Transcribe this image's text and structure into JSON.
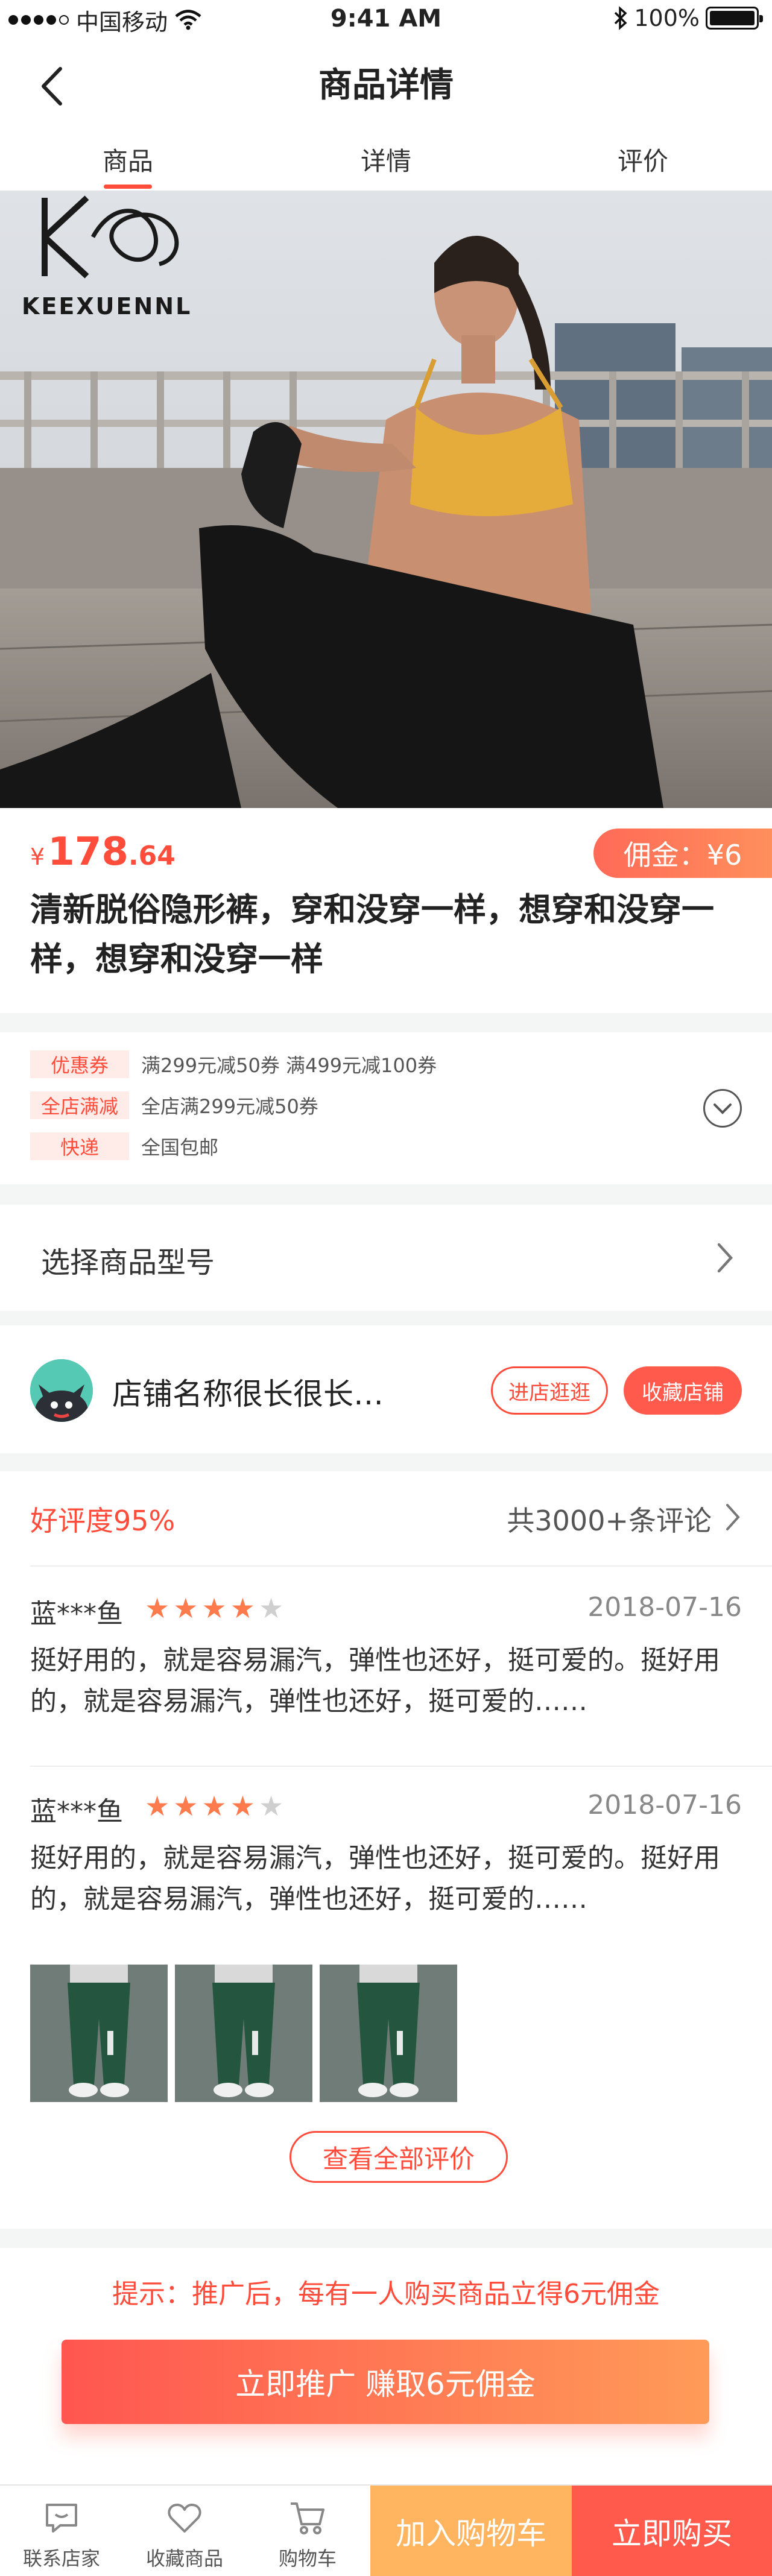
{
  "status_bar": {
    "carrier": "中国移动",
    "time": "9:41 AM",
    "battery": "100%"
  },
  "nav": {
    "title": "商品详情",
    "back_icon": "chevron-left-icon"
  },
  "tabs": [
    {
      "label": "商品",
      "active": true
    },
    {
      "label": "详情",
      "active": false
    },
    {
      "label": "评价",
      "active": false
    }
  ],
  "hero": {
    "brand_logo_text": "KEEXUENNL"
  },
  "product": {
    "price_symbol": "¥",
    "price_int": "178",
    "price_dec": ".64",
    "commission": "佣金：¥6",
    "title": "清新脱俗隐形裤，穿和没穿一样，想穿和没穿一样，想穿和没穿一样"
  },
  "promo": [
    {
      "tag": "优惠券",
      "text": "满299元减50券    满499元减100券"
    },
    {
      "tag": "全店满减",
      "text": "全店满299元减50券"
    },
    {
      "tag": "快递",
      "text": "全国包邮"
    }
  ],
  "model": {
    "label": "选择商品型号"
  },
  "shop": {
    "name": "店铺名称很长很长…",
    "visit_label": "进店逛逛",
    "favorite_label": "收藏店铺"
  },
  "reviews": {
    "rating": "好评度95%",
    "count": "共3000+条评论",
    "items": [
      {
        "user": "蓝***鱼",
        "stars": 4,
        "max_stars": 5,
        "date": "2018-07-16",
        "text": "挺好用的，就是容易漏汽，弹性也还好，挺可爱的。挺好用的，就是容易漏汽，弹性也还好，挺可爱的……"
      },
      {
        "user": "蓝***鱼",
        "stars": 4,
        "max_stars": 5,
        "date": "2018-07-16",
        "text": "挺好用的，就是容易漏汽，弹性也还好，挺可爱的。挺好用的，就是容易漏汽，弹性也还好，挺可爱的……"
      }
    ],
    "view_all_label": "查看全部评价"
  },
  "tip": {
    "text": "提示：推广后，每有一人购买商品立得6元佣金",
    "promote_label": "立即推广 赚取6元佣金"
  },
  "bottom_bar": {
    "contact_label": "联系店家",
    "favorite_label": "收藏商品",
    "cart_label": "购物车",
    "add_cart_label": "加入购物车",
    "buy_label": "立即购买"
  },
  "colors": {
    "accent": "#ff4c3b",
    "orange": "#ffb45f",
    "background_gap": "#f4f6f6"
  }
}
